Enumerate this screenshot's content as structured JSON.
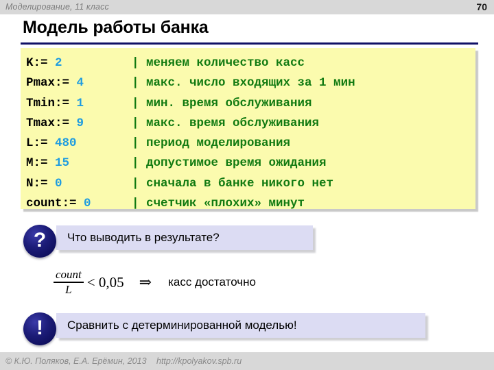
{
  "header": {
    "subject": "Моделирование, 11 класс",
    "page_number": "70"
  },
  "title": "Модель работы банка",
  "code": {
    "lines": [
      {
        "name": "K:=",
        "value": "2",
        "pipe": "|",
        "comment": "меняем количество касс"
      },
      {
        "name": "Pmax:=",
        "value": "4",
        "pipe": "|",
        "comment": "макс. число входящих за 1 мин"
      },
      {
        "name": "Tmin:=",
        "value": "1",
        "pipe": "|",
        "comment": "мин. время обслуживания"
      },
      {
        "name": "Tmax:=",
        "value": "9",
        "pipe": "|",
        "comment": "макс. время обслуживания"
      },
      {
        "name": "L:=",
        "value": "480",
        "pipe": "|",
        "comment": "период моделирования"
      },
      {
        "name": "M:=",
        "value": "15",
        "pipe": "|",
        "comment": "допустимое время ожидания"
      },
      {
        "name": "N:=",
        "value": "0",
        "pipe": "|",
        "comment": "сначала в банке никого нет"
      },
      {
        "name": "count:=",
        "value": "0",
        "pipe": "|",
        "comment": "счетчик «плохих» минут"
      }
    ],
    "colors": {
      "background": "#fbfbae",
      "identifier": "#000000",
      "number": "#1f9ce0",
      "comment": "#117a11"
    }
  },
  "callouts": [
    {
      "glyph": "?",
      "text": "Что выводить в результате?"
    },
    {
      "glyph": "!",
      "text": "Сравнить с детерминированной моделью!"
    }
  ],
  "formula": {
    "numerator": "count",
    "denominator": "L",
    "relation": "< 0,05",
    "implies": "⇒",
    "conclusion": "касс достаточно"
  },
  "footer": {
    "copyright": "© К.Ю. Поляков, Е.А. Ерёмин, 2013",
    "url": "http://kpolyakov.spb.ru"
  },
  "theme": {
    "header_band": "#d8d8d8",
    "accent_navy": "#111166",
    "callout_box": "#dcdcf3"
  }
}
